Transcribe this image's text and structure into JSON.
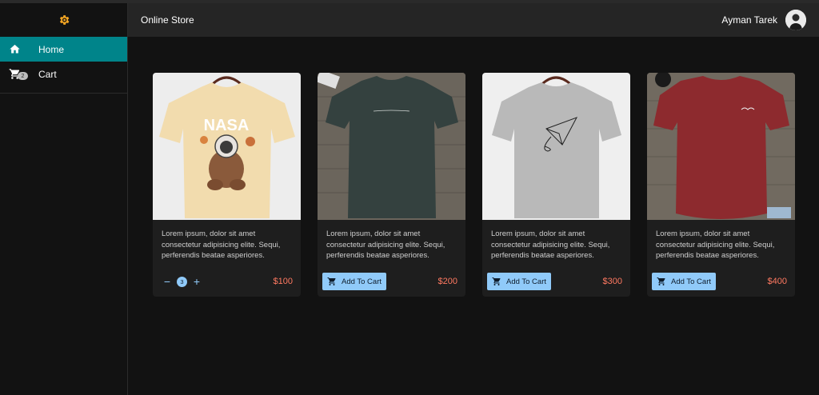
{
  "app": {
    "title": "Online Store"
  },
  "user": {
    "name": "Ayman Tarek"
  },
  "sidebar": {
    "items": [
      {
        "label": "Home",
        "icon": "home-icon",
        "active": true
      },
      {
        "label": "Cart",
        "icon": "cart-icon",
        "badge": "2"
      }
    ]
  },
  "colors": {
    "accent": "#00848a",
    "button": "#90caf9",
    "price": "#ff7961",
    "logo": "#f5a623"
  },
  "products": [
    {
      "description": "Lorem ipsum, dolor sit amet consectetur adipisicing elite. Sequi, perferendis beatae asperiores.",
      "price": "$100",
      "in_cart": true,
      "quantity": "3",
      "shirt_color": "#f2dcae",
      "bg": "#ededed"
    },
    {
      "description": "Lorem ipsum, dolor sit amet consectetur adipisicing elite. Sequi, perferendis beatae asperiores.",
      "price": "$200",
      "in_cart": false,
      "button_label": "Add To Cart",
      "shirt_color": "#34413f",
      "bg": "#6b655c"
    },
    {
      "description": "Lorem ipsum, dolor sit amet consectetur adipisicing elite. Sequi, perferendis beatae asperiores.",
      "price": "$300",
      "in_cart": false,
      "button_label": "Add To Cart",
      "shirt_color": "#b9b9b9",
      "bg": "#efefef"
    },
    {
      "description": "Lorem ipsum, dolor sit amet consectetur adipisicing elite. Sequi, perferendis beatae asperiores.",
      "price": "$400",
      "in_cart": false,
      "button_label": "Add To Cart",
      "shirt_color": "#8d2a2e",
      "bg": "#716a60"
    }
  ]
}
